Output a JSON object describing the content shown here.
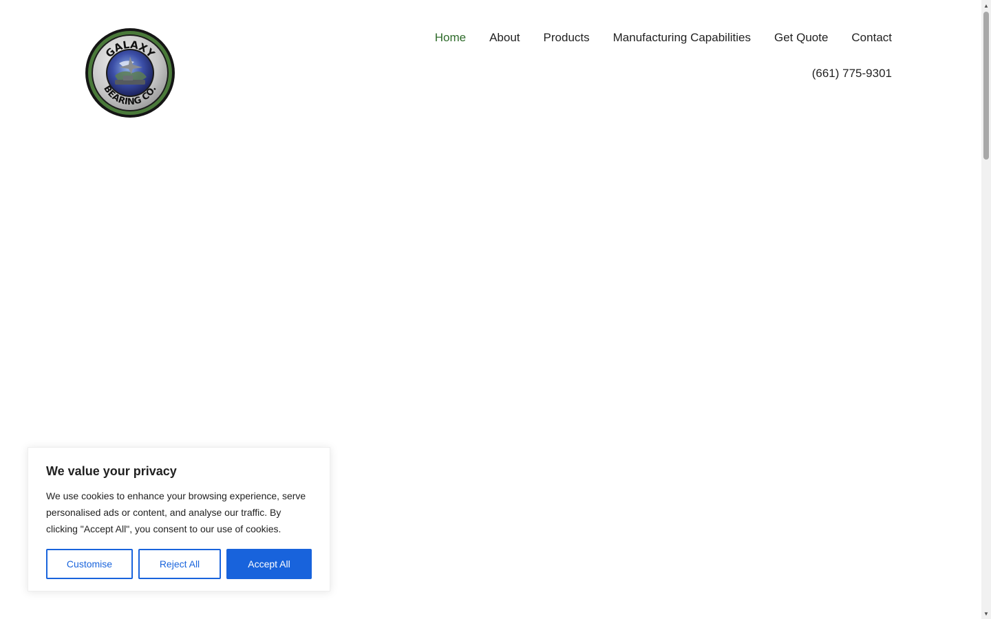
{
  "logo": {
    "top_text": "GALAXY",
    "bottom_text": "BEARING CO.",
    "ring_color": "#4a7a3a"
  },
  "nav": {
    "items": [
      {
        "label": "Home",
        "active": true
      },
      {
        "label": "About",
        "active": false
      },
      {
        "label": "Products",
        "active": false
      },
      {
        "label": "Manufacturing Capabilities",
        "active": false
      },
      {
        "label": "Get Quote",
        "active": false
      },
      {
        "label": "Contact",
        "active": false
      }
    ],
    "phone": "(661) 775-9301"
  },
  "colors": {
    "accent": "#2e6b2a",
    "button_blue": "#1863dc",
    "text": "#222222"
  },
  "cookie_banner": {
    "title": "We value your privacy",
    "body": "We use cookies to enhance your browsing experience, serve personalised ads or content, and analyse our traffic. By clicking \"Accept All\", you consent to our use of cookies.",
    "buttons": {
      "customise": "Customise",
      "reject": "Reject All",
      "accept": "Accept All"
    }
  },
  "scrollbar": {
    "up_icon": "triangle-up",
    "down_icon": "triangle-down"
  }
}
